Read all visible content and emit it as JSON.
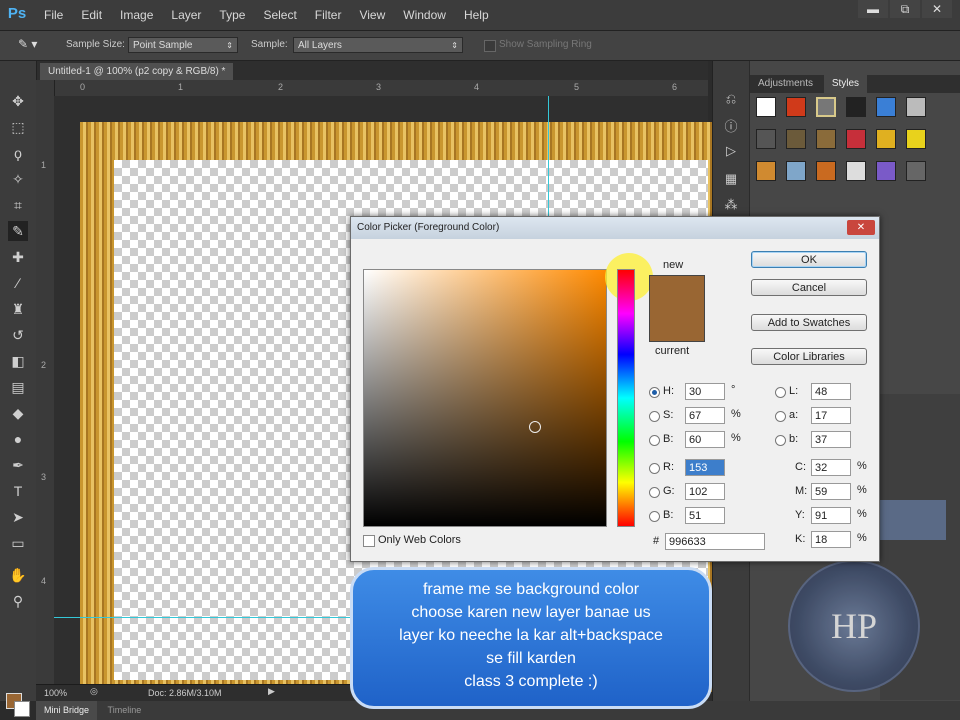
{
  "app": {
    "logo": "Ps"
  },
  "menu": [
    "File",
    "Edit",
    "Image",
    "Layer",
    "Type",
    "Select",
    "Filter",
    "View",
    "Window",
    "Help"
  ],
  "window_controls": [
    "▬",
    "⧉",
    "✕"
  ],
  "options": {
    "sample_size_label": "Sample Size:",
    "sample_size_value": "Point Sample",
    "sample_label": "Sample:",
    "sample_value": "All Layers",
    "show_ring_label": "Show Sampling Ring"
  },
  "document": {
    "tab_title": "Untitled-1 @ 100% (p2 copy & RGB/8) *"
  },
  "status": {
    "zoom": "100%",
    "doc": "Doc: 2.86M/3.10M"
  },
  "bottom_tabs": [
    "Mini Bridge",
    "Timeline"
  ],
  "panel": {
    "tabs": [
      "Adjustments",
      "Styles"
    ],
    "active_tab": "Styles"
  },
  "dialog": {
    "title": "Color Picker (Foreground Color)",
    "close": "✕",
    "new_label": "new",
    "current_label": "current",
    "buttons": {
      "ok": "OK",
      "cancel": "Cancel",
      "add_swatches": "Add to Swatches",
      "color_libraries": "Color Libraries"
    },
    "hsb": {
      "h": "30",
      "s": "67",
      "b": "60"
    },
    "rgb": {
      "r": "153",
      "g": "102",
      "b": "51"
    },
    "lab": {
      "l": "48",
      "a": "17",
      "b": "37"
    },
    "cmyk": {
      "c": "32",
      "m": "59",
      "y": "91",
      "k": "18"
    },
    "hex": "996633",
    "only_web_colors": "Only Web Colors",
    "labels": {
      "h": "H:",
      "s": "S:",
      "b": "B:",
      "r": "R:",
      "g": "G:",
      "bb": "B:",
      "l": "L:",
      "a": "a:",
      "lb": "b:",
      "c": "C:",
      "m": "M:",
      "y": "Y:",
      "k": "K:",
      "hash": "#"
    },
    "units": {
      "deg": "°",
      "pct": "%"
    },
    "colors": {
      "selected": "#996633"
    }
  },
  "caption": {
    "lines": [
      "frame me se background color",
      "choose karen new layer banae us",
      "layer ko neeche la kar alt+backspace",
      "se fill karden",
      "class 3 complete :)"
    ]
  },
  "watermark": {
    "text": "HP"
  }
}
